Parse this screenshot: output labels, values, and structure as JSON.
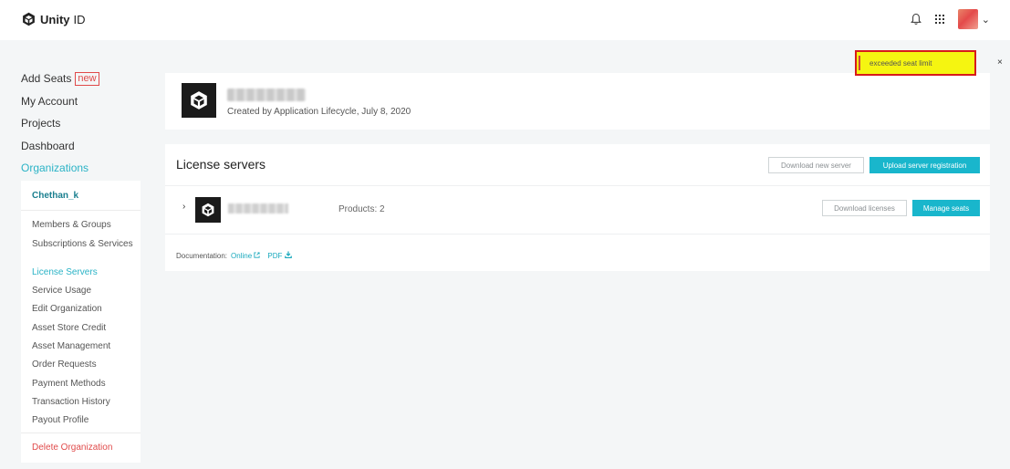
{
  "header": {
    "logo_bold": "Unity",
    "logo_rest": "ID"
  },
  "sidebar": {
    "links": [
      {
        "label": "Add Seats",
        "badge": "new"
      },
      {
        "label": "My Account"
      },
      {
        "label": "Projects"
      },
      {
        "label": "Dashboard"
      },
      {
        "label": "Organizations",
        "active": true
      }
    ],
    "org": {
      "name": "Chethan_k",
      "items": [
        "Members & Groups",
        "Subscriptions & Services",
        "License Servers",
        "Service Usage",
        "Edit Organization",
        "Asset Store Credit",
        "Asset Management",
        "Order Requests",
        "Payment Methods",
        "Transaction History",
        "Payout Profile"
      ],
      "active_item": "License Servers",
      "delete_label": "Delete Organization"
    }
  },
  "org_card": {
    "created_text": "Created by Application Lifecycle, July 8, 2020"
  },
  "license_servers": {
    "title": "License servers",
    "download_new_server": "Download new server",
    "upload_registration": "Upload server registration",
    "server": {
      "products": "Products: 2",
      "download_licenses": "Download licenses",
      "manage_seats": "Manage seats"
    },
    "documentation_label": "Documentation:",
    "doc_online": "Online",
    "doc_pdf": "PDF"
  },
  "toast": {
    "message": "exceeded seat limit",
    "close": "×"
  },
  "colors": {
    "accent": "#19b6cc",
    "danger": "#e04a4a",
    "toast_bg": "#f5f511"
  }
}
